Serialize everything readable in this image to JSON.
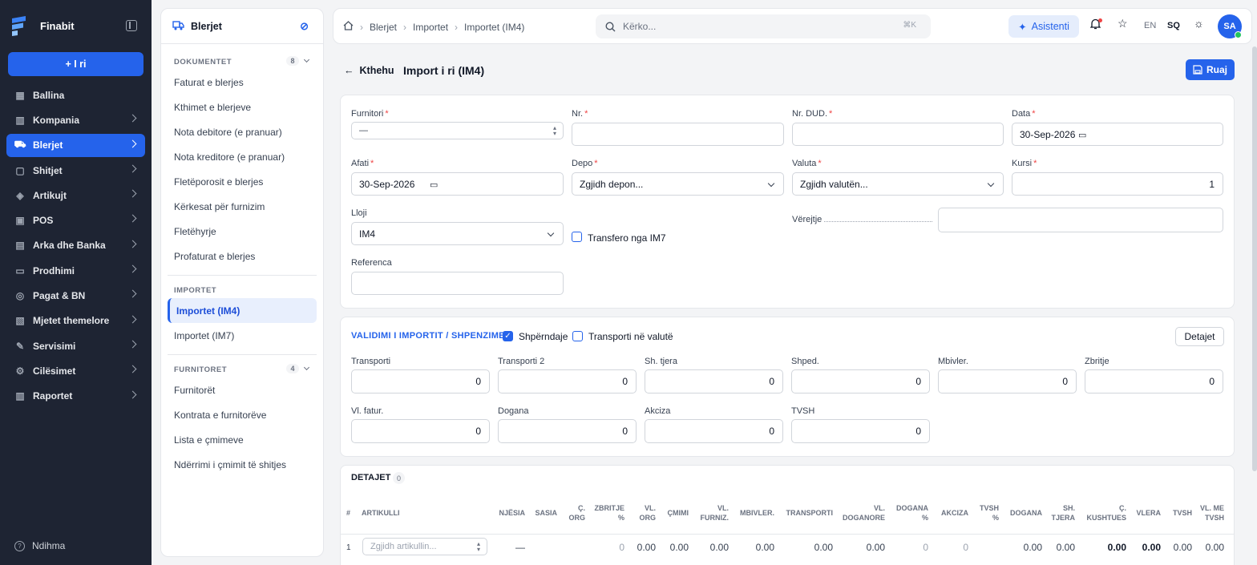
{
  "app": {
    "name": "Finabit",
    "new_label": "+ I ri",
    "help_label": "Ndihma"
  },
  "nav": [
    {
      "label": "Ballina",
      "icon": "dashboard-icon",
      "active": false,
      "has_children": false
    },
    {
      "label": "Kompania",
      "icon": "building-icon",
      "active": false,
      "has_children": true
    },
    {
      "label": "Blerjet",
      "icon": "truck-icon",
      "active": true,
      "has_children": true
    },
    {
      "label": "Shitjet",
      "icon": "shopping-bag-icon",
      "active": false,
      "has_children": true
    },
    {
      "label": "Artikujt",
      "icon": "box-icon",
      "active": false,
      "has_children": true
    },
    {
      "label": "POS",
      "icon": "pos-icon",
      "active": false,
      "has_children": true
    },
    {
      "label": "Arka dhe Banka",
      "icon": "wallet-icon",
      "active": false,
      "has_children": true
    },
    {
      "label": "Prodhimi",
      "icon": "factory-icon",
      "active": false,
      "has_children": true
    },
    {
      "label": "Pagat & BN",
      "icon": "coins-icon",
      "active": false,
      "has_children": true
    },
    {
      "label": "Mjetet themelore",
      "icon": "assets-icon",
      "active": false,
      "has_children": true
    },
    {
      "label": "Servisimi",
      "icon": "wrench-icon",
      "active": false,
      "has_children": true
    },
    {
      "label": "Cilësimet",
      "icon": "gear-icon",
      "active": false,
      "has_children": true
    },
    {
      "label": "Raportet",
      "icon": "chart-icon",
      "active": false,
      "has_children": true
    }
  ],
  "subpanel": {
    "title": "Blerjet",
    "sections": [
      {
        "title": "DOKUMENTET",
        "count": "8",
        "items": [
          "Faturat e blerjes",
          "Kthimet e blerjeve",
          "Nota debitore (e pranuar)",
          "Nota kreditore (e pranuar)",
          "Fletëporosit e blerjes",
          "Kërkesat për furnizim",
          "Fletëhyrje",
          "Profaturat e blerjes"
        ]
      },
      {
        "title": "IMPORTET",
        "count": "",
        "items": [
          "Importet (IM4)",
          "Importet (IM7)"
        ]
      },
      {
        "title": "FURNITORET",
        "count": "4",
        "items": [
          "Furnitorët",
          "Kontrata e furnitorëve",
          "Lista e çmimeve",
          "Ndërrimi i çmimit të shitjes"
        ]
      }
    ],
    "active_item": "Importet (IM4)"
  },
  "topbar": {
    "breadcrumbs": [
      "Blerjet",
      "Importet",
      "Importet (IM4)"
    ],
    "search_placeholder": "Kërko...",
    "search_shortcut": "⌘K",
    "assistant_label": "Asistenti",
    "lang_en": "EN",
    "lang_sq": "SQ",
    "avatar_initials": "SA"
  },
  "page": {
    "back_label": "Kthehu",
    "title": "Import i ri (IM4)",
    "save_label": "Ruaj"
  },
  "form": {
    "furnitori": {
      "label": "Furnitori",
      "value": "—"
    },
    "nr": {
      "label": "Nr.",
      "value": ""
    },
    "nr_dud": {
      "label": "Nr. DUD.",
      "value": ""
    },
    "data": {
      "label": "Data",
      "value": "30-Sep-2026"
    },
    "afati": {
      "label": "Afati",
      "value": "30-Sep-2026"
    },
    "depo": {
      "label": "Depo",
      "value": "Zgjidh depon..."
    },
    "valuta": {
      "label": "Valuta",
      "value": "Zgjidh valutën..."
    },
    "kursi": {
      "label": "Kursi",
      "value": "1"
    },
    "lloji": {
      "label": "Lloji",
      "value": "IM4"
    },
    "transfero": {
      "label": "Transfero nga IM7",
      "checked": false
    },
    "verejtje": {
      "label": "Vërejtje",
      "value": ""
    },
    "referenca": {
      "label": "Referenca",
      "value": ""
    }
  },
  "validation": {
    "title": "VALIDIMI I IMPORTIT / SHPENZIMET",
    "shperndaje": {
      "label": "Shpërndaje",
      "checked": true
    },
    "transport_valute": {
      "label": "Transporti në valutë",
      "checked": false
    },
    "details_button": "Detajet",
    "fields": [
      {
        "label": "Transporti",
        "value": "0"
      },
      {
        "label": "Transporti 2",
        "value": "0"
      },
      {
        "label": "Sh. tjera",
        "value": "0"
      },
      {
        "label": "Shped.",
        "value": "0"
      },
      {
        "label": "Mbivler.",
        "value": "0"
      },
      {
        "label": "Zbritje",
        "value": "0"
      },
      {
        "label": "Vl. fatur.",
        "value": "0"
      },
      {
        "label": "Dogana",
        "value": "0"
      },
      {
        "label": "Akciza",
        "value": "0"
      },
      {
        "label": "TVSH",
        "value": "0"
      }
    ]
  },
  "details": {
    "title": "DETAJET",
    "count": "0",
    "columns": [
      "#",
      "ARTIKULLI",
      "NJËSIA",
      "SASIA",
      "Ç. ORG",
      "ZBRITJE %",
      "VL. ORG",
      "ÇMIMI",
      "VL. FURNIZ.",
      "MBIVLER.",
      "TRANSPORTI",
      "VL. DOGANORE",
      "DOGANA %",
      "AKCIZA",
      "TVSH %",
      "DOGANA",
      "SH. TJERA",
      "Ç. KUSHTUES",
      "VLERA",
      "TVSH",
      "VL. ME TVSH"
    ],
    "row": {
      "num": "1",
      "article_placeholder": "Zgjidh artikullin...",
      "unit": "—",
      "qty": "",
      "c_org": "",
      "discount": "0",
      "vl_org": "0.00",
      "cmimi": "0.00",
      "vl_furniz": "0.00",
      "mbivler": "0.00",
      "transporti": "0.00",
      "vl_doganore": "0.00",
      "dogana_pct": "0",
      "akciza": "0",
      "tvsh_pct": "",
      "dogana": "0.00",
      "sh_tjera": "0.00",
      "c_kushtues": "0.00",
      "vlera": "0.00",
      "tvsh": "0.00",
      "vl_me_tvsh": "0.00"
    }
  },
  "colors": {
    "accent": "#2563eb",
    "sidebar_bg": "#1e2433",
    "required": "#ef4444"
  }
}
